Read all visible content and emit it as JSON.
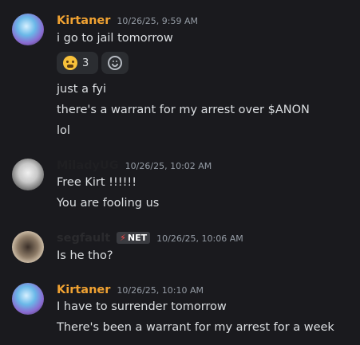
{
  "messages": [
    {
      "author": "Kirtaner",
      "timestamp": "10/26/25, 9:59 AM",
      "lines": [
        "i go to jail tomorrow"
      ],
      "reactions": [
        {
          "emoji": "weary-face",
          "count": "3"
        },
        {
          "emoji": "add-reaction"
        }
      ],
      "followups": [
        "just a fyi",
        "there's a warrant for my arrest over $ANON",
        "lol"
      ]
    },
    {
      "author": "MiladyUG",
      "timestamp": "10/26/25, 10:02 AM",
      "lines": [
        "Free Kirt !!!!!!",
        "You are fooling us"
      ]
    },
    {
      "author": "segfault",
      "tag": "NET",
      "timestamp": "10/26/25, 10:06 AM",
      "lines": [
        "Is he tho?"
      ]
    },
    {
      "author": "Kirtaner",
      "timestamp": "10/26/25, 10:10 AM",
      "lines": [
        "I have to surrender tomorrow",
        "There's been a warrant for my arrest for a week"
      ]
    }
  ],
  "colors": {
    "background": "#1a1a1e",
    "kirtaner_name": "#f0a232",
    "timestamp": "#949ba4",
    "text": "#dbdee1"
  }
}
